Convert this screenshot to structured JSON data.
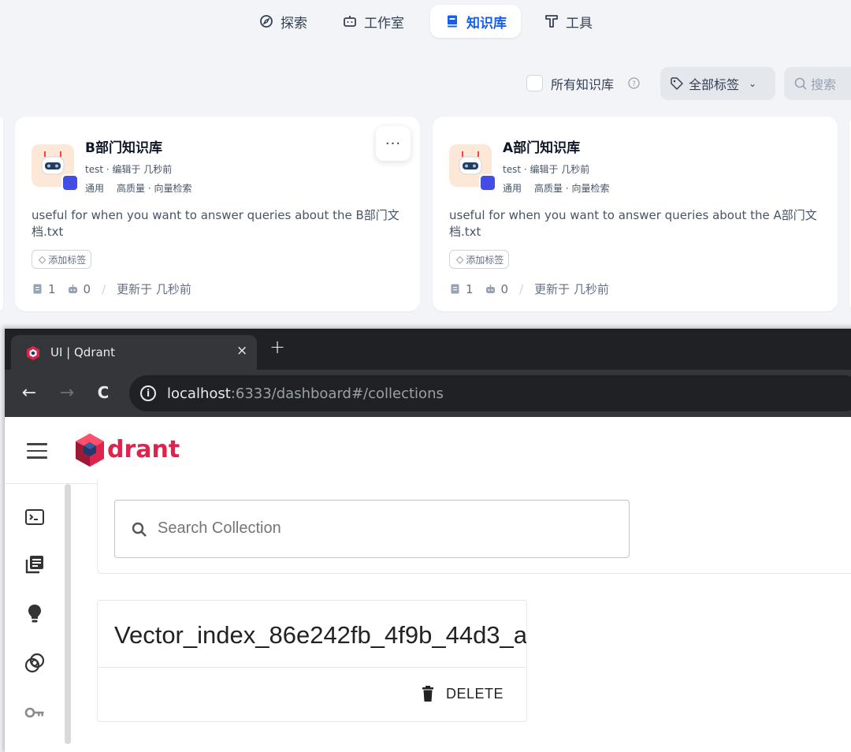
{
  "dify": {
    "nav": [
      {
        "label": "探索",
        "icon": "compass-icon"
      },
      {
        "label": "工作室",
        "icon": "robot-icon"
      },
      {
        "label": "知识库",
        "icon": "book-icon",
        "active": true
      },
      {
        "label": "工具",
        "icon": "tool-icon"
      }
    ],
    "filter": {
      "all_kb_label": "所有知识库",
      "tags_label": "全部标签",
      "search_placeholder": "搜索"
    },
    "cards": [
      {
        "title": "B部门知识库",
        "meta": "test · 编辑于 几秒前",
        "mode": "通用",
        "index": "高质量 · 向量检索",
        "desc": "useful for when you want to answer queries about the B部门文档.txt",
        "tag": "添加标签",
        "docs": "1",
        "apps": "0",
        "updated": "更新于 几秒前",
        "more": "···"
      },
      {
        "title": "A部门知识库",
        "meta": "test · 编辑于 几秒前",
        "mode": "通用",
        "index": "高质量 · 向量检索",
        "desc": "useful for when you want to answer queries about the A部门文档.txt",
        "tag": "添加标签",
        "docs": "1",
        "apps": "0",
        "updated": "更新于 几秒前"
      }
    ],
    "colors": {
      "accent": "#155eef",
      "badge": "#444ce7"
    }
  },
  "browser": {
    "tab_title": "UI | Qdrant",
    "tab_close": "×",
    "new_tab": "+",
    "url_host": "localhost",
    "url_rest": ":6333/dashboard#/collections",
    "nav": {
      "back": "←",
      "forward": "→",
      "reload": "C"
    }
  },
  "qdrant": {
    "logo_text": "drant",
    "search_placeholder": "Search Collection",
    "collection_name": "Vector_index_86e242fb_4f9b_44d3_a",
    "delete_label": "DELETE",
    "sidebar": [
      "console-icon",
      "collections-icon",
      "tutorial-icon",
      "datasets-icon",
      "access-keys-icon"
    ],
    "colors": {
      "brand": "#dc244c"
    }
  }
}
